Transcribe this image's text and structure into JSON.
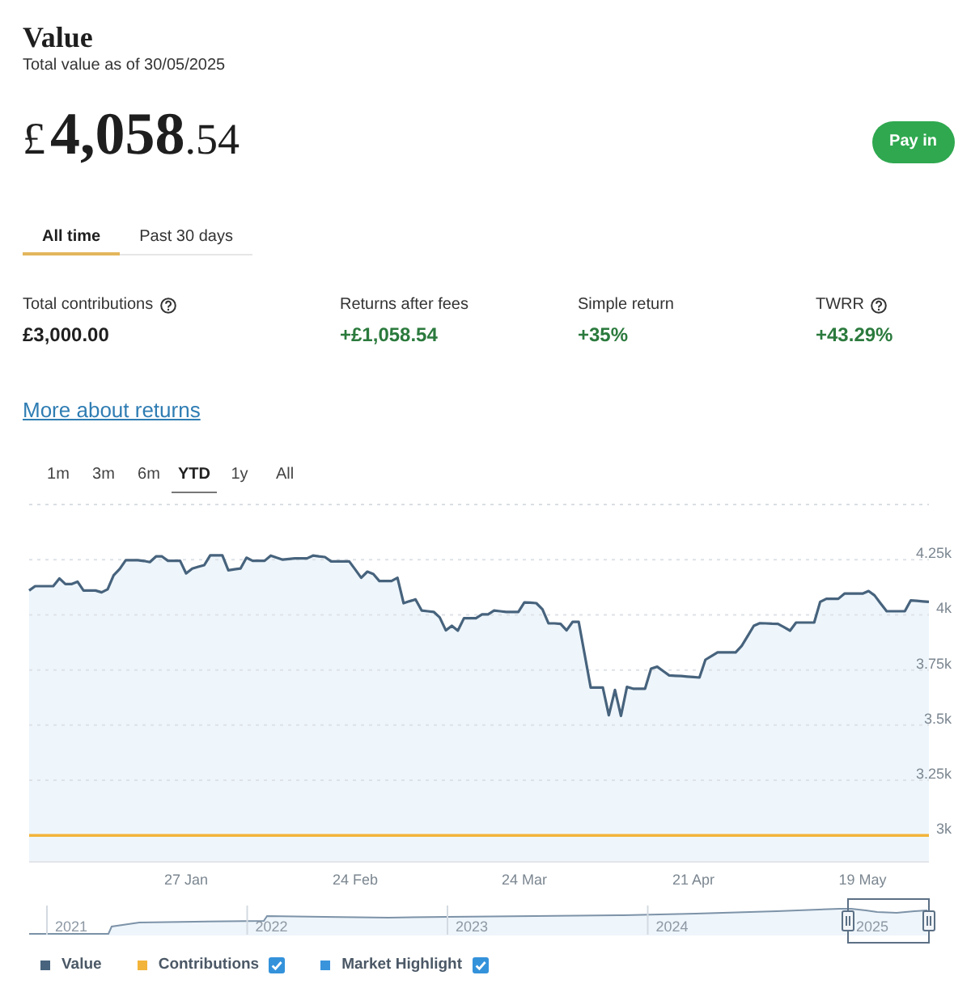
{
  "header": {
    "title": "Value",
    "subtitle": "Total value as of 30/05/2025"
  },
  "balance": {
    "currency": "£",
    "whole": "4,058",
    "fraction": ".54"
  },
  "pay_in_button": "Pay in",
  "period_tabs": [
    {
      "label": "All time",
      "selected": true
    },
    {
      "label": "Past 30 days",
      "selected": false
    }
  ],
  "stats": [
    {
      "label": "Total contributions",
      "help": true,
      "value": "£3,000.00",
      "kind": "plain"
    },
    {
      "label": "Returns after fees",
      "help": false,
      "value": "+£1,058.54",
      "kind": "gain"
    },
    {
      "label": "Simple return",
      "help": false,
      "value": "+35%",
      "kind": "gain"
    },
    {
      "label": "TWRR",
      "help": true,
      "value": "+43.29%",
      "kind": "gain"
    }
  ],
  "link": "More about returns",
  "range_tabs": [
    {
      "label": "1m",
      "selected": false
    },
    {
      "label": "3m",
      "selected": false
    },
    {
      "label": "6m",
      "selected": false
    },
    {
      "label": "YTD",
      "selected": true
    },
    {
      "label": "1y",
      "selected": false
    },
    {
      "label": "All",
      "selected": false
    }
  ],
  "chart": {
    "chart_data": {
      "type": "line",
      "grid": true,
      "categories": [
        null,
        null,
        null,
        null,
        null,
        null,
        null,
        null,
        null,
        null,
        null,
        null,
        null,
        null,
        null,
        null,
        null,
        null,
        null,
        null,
        null,
        null,
        null,
        null,
        null,
        null,
        "27 Jan",
        null,
        null,
        null,
        null,
        null,
        null,
        null,
        null,
        null,
        null,
        null,
        null,
        null,
        null,
        null,
        null,
        null,
        null,
        null,
        null,
        null,
        null,
        null,
        null,
        null,
        null,
        null,
        "24 Feb",
        null,
        null,
        null,
        null,
        null,
        null,
        null,
        null,
        null,
        null,
        null,
        null,
        null,
        null,
        null,
        null,
        null,
        null,
        null,
        null,
        null,
        null,
        null,
        null,
        null,
        null,
        null,
        "24 Mar",
        null,
        null,
        null,
        null,
        null,
        null,
        null,
        null,
        null,
        null,
        null,
        null,
        null,
        null,
        null,
        null,
        null,
        null,
        null,
        null,
        null,
        null,
        null,
        null,
        null,
        null,
        null,
        "21 Apr",
        null,
        null,
        null,
        null,
        null,
        null,
        null,
        null,
        null,
        null,
        null,
        null,
        null,
        null,
        null,
        null,
        null,
        null,
        null,
        null,
        null,
        null,
        null,
        null,
        null,
        null,
        null,
        "19 May",
        null,
        null,
        null,
        null,
        null,
        null,
        null,
        null,
        null,
        null,
        null
      ],
      "ylim": [
        2880,
        4500
      ],
      "yticks": [
        {
          "value": 3000,
          "label": "3k"
        },
        {
          "value": 3250,
          "label": "3.25k"
        },
        {
          "value": 3500,
          "label": "3.5k"
        },
        {
          "value": 3750,
          "label": "3.75k"
        },
        {
          "value": 4000,
          "label": "4k"
        },
        {
          "value": 4250,
          "label": "4.25k"
        }
      ],
      "series": [
        {
          "name": "Value",
          "color": "#47637d",
          "values": [
            4110,
            4130,
            4130,
            4130,
            4130,
            4165,
            4139,
            4139,
            4150,
            4110,
            4110,
            4110,
            4102,
            4116,
            4179,
            4208,
            4248,
            4248,
            4248,
            4244,
            4239,
            4265,
            4265,
            4245,
            4245,
            4245,
            4188,
            4210,
            4218,
            4225,
            4270,
            4270,
            4270,
            4202,
            4206,
            4210,
            4259,
            4245,
            4245,
            4245,
            4268,
            4259,
            4250,
            4253,
            4256,
            4256,
            4256,
            4268,
            4265,
            4262,
            4242,
            4242,
            4242,
            4242,
            4205,
            4168,
            4196,
            4185,
            4153,
            4153,
            4153,
            4168,
            4053,
            4062,
            4070,
            4019,
            4016,
            4013,
            3988,
            3930,
            3950,
            3928,
            3985,
            3985,
            3985,
            4002,
            4002,
            4019,
            4016,
            4013,
            4013,
            4013,
            4056,
            4055,
            4053,
            4025,
            3962,
            3961,
            3959,
            3930,
            3968,
            3968,
            3819,
            3670,
            3670,
            3670,
            3545,
            3659,
            3542,
            3673,
            3665,
            3665,
            3665,
            3756,
            3765,
            3745,
            3725,
            3724,
            3722,
            3720,
            3718,
            3716,
            3796,
            3813,
            3830,
            3830,
            3830,
            3830,
            3859,
            3905,
            3950,
            3962,
            3961,
            3960,
            3959,
            3944,
            3928,
            3965,
            3965,
            3965,
            3965,
            4059,
            4073,
            4073,
            4073,
            4096,
            4096,
            4096,
            4096,
            4108,
            4088,
            4052,
            4016,
            4016,
            4016,
            4016,
            4065,
            4063,
            4061,
            4059
          ]
        },
        {
          "name": "Contributions",
          "color": "#f2b43a",
          "values": [
            3000,
            3000,
            3000,
            3000,
            3000,
            3000,
            3000,
            3000,
            3000,
            3000,
            3000,
            3000,
            3000,
            3000,
            3000,
            3000,
            3000,
            3000,
            3000,
            3000,
            3000,
            3000,
            3000,
            3000,
            3000,
            3000,
            3000,
            3000,
            3000,
            3000,
            3000,
            3000,
            3000,
            3000,
            3000,
            3000,
            3000,
            3000,
            3000,
            3000,
            3000,
            3000,
            3000,
            3000,
            3000,
            3000,
            3000,
            3000,
            3000,
            3000,
            3000,
            3000,
            3000,
            3000,
            3000,
            3000,
            3000,
            3000,
            3000,
            3000,
            3000,
            3000,
            3000,
            3000,
            3000,
            3000,
            3000,
            3000,
            3000,
            3000,
            3000,
            3000,
            3000,
            3000,
            3000,
            3000,
            3000,
            3000,
            3000,
            3000,
            3000,
            3000,
            3000,
            3000,
            3000,
            3000,
            3000,
            3000,
            3000,
            3000,
            3000,
            3000,
            3000,
            3000,
            3000,
            3000,
            3000,
            3000,
            3000,
            3000,
            3000,
            3000,
            3000,
            3000,
            3000,
            3000,
            3000,
            3000,
            3000,
            3000,
            3000,
            3000,
            3000,
            3000,
            3000,
            3000,
            3000,
            3000,
            3000,
            3000,
            3000,
            3000,
            3000,
            3000,
            3000,
            3000,
            3000,
            3000,
            3000,
            3000,
            3000,
            3000,
            3000,
            3000,
            3000,
            3000,
            3000,
            3000,
            3000,
            3000,
            3000,
            3000,
            3000,
            3000,
            3000,
            3000,
            3000,
            3000,
            3000,
            3000
          ]
        }
      ]
    }
  },
  "navigator": {
    "years": [
      "2021",
      "2022",
      "2023",
      "2024",
      "2025"
    ]
  },
  "legend": [
    {
      "kind": "plain"
    },
    {
      "kind": "toggle",
      "checked": true
    },
    {
      "kind": "toggle",
      "label": "Market Highlight",
      "color": "#3a94dc",
      "checked": true
    }
  ]
}
